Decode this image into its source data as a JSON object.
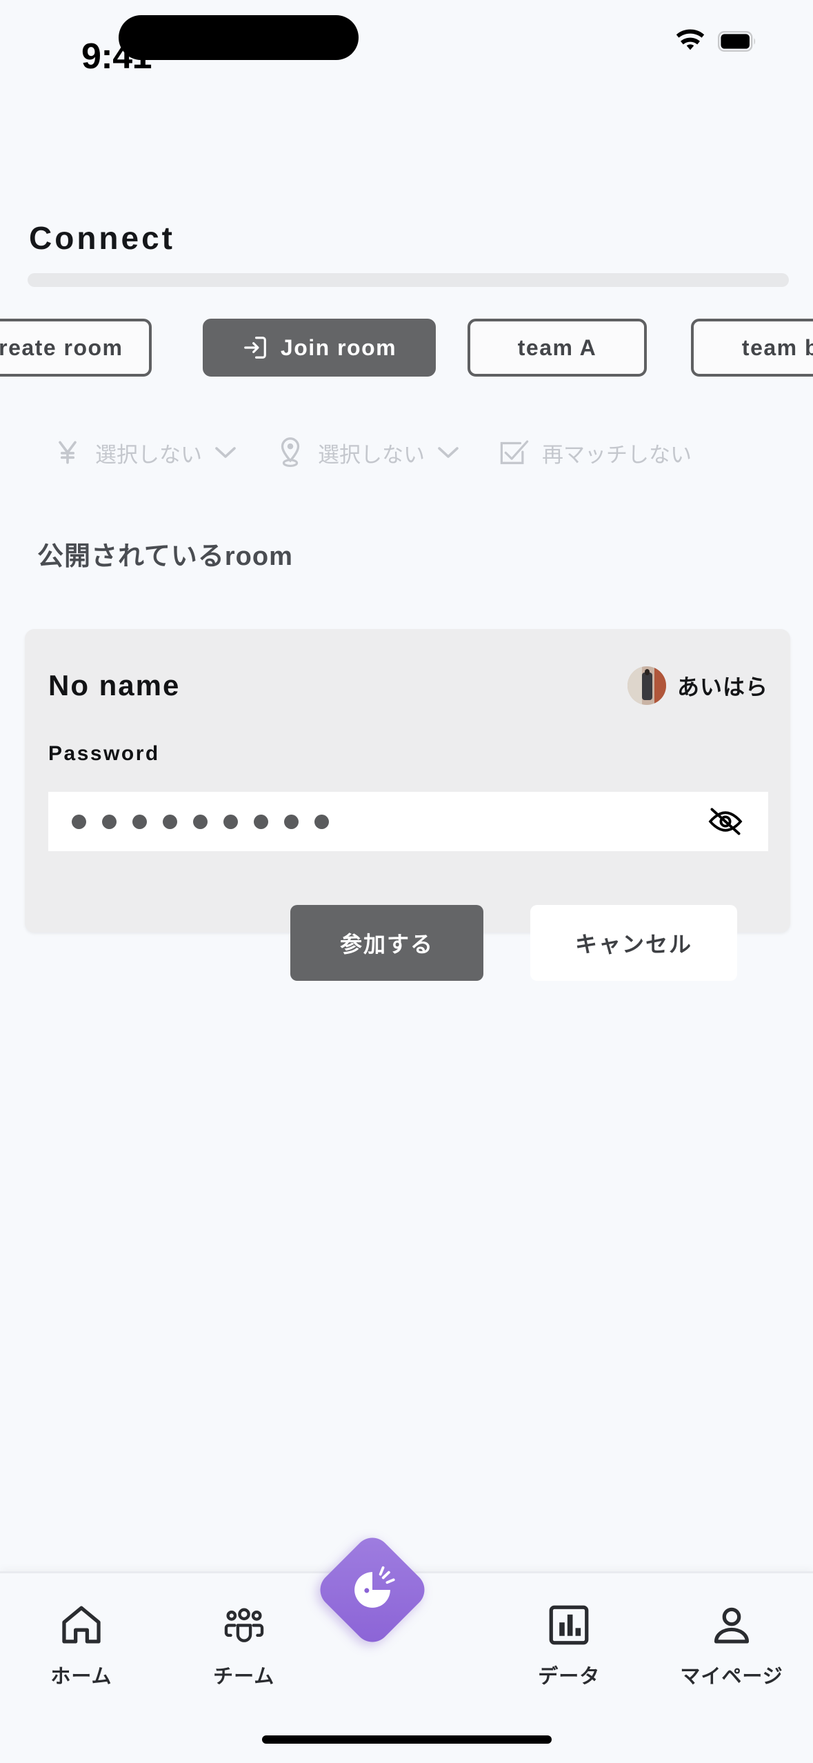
{
  "status_bar": {
    "time": "9:41",
    "wifi_icon": "wifi-icon",
    "battery_icon": "battery-icon",
    "dynamic_island": "dynamic-island"
  },
  "header": {
    "title": "Connect"
  },
  "chips": [
    {
      "label": "Create room",
      "state": "inactive",
      "icon": null
    },
    {
      "label": "Join room",
      "state": "active",
      "icon": "login-arrow-icon"
    },
    {
      "label": "team A",
      "state": "inactive",
      "icon": null
    },
    {
      "label": "team b",
      "state": "inactive",
      "icon": null
    }
  ],
  "filters": [
    {
      "icon": "yen-icon",
      "value": "選択しない",
      "chevron": "chevron-down-icon"
    },
    {
      "icon": "location-pin-icon",
      "value": "選択しない",
      "chevron": "chevron-down-icon"
    },
    {
      "icon": "checkbox-checked-icon",
      "value": "再マッチしない",
      "chevron": null
    }
  ],
  "section": {
    "heading": "公開されているroom"
  },
  "room_card": {
    "name": "No name",
    "owner_name": "あいはら",
    "avatar_icon": "avatar",
    "password_label": "Password",
    "password_dots": 9,
    "password_visibility_icon": "eye-off-icon",
    "join_button": "参加する",
    "cancel_button": "キャンセル"
  },
  "tabbar": {
    "items": [
      {
        "icon": "home-icon",
        "label": "ホーム"
      },
      {
        "icon": "team-group-icon",
        "label": "チーム"
      },
      {
        "icon": "bar-chart-icon",
        "label": "データ"
      },
      {
        "icon": "person-icon",
        "label": "マイページ"
      }
    ],
    "fab_icon": "mascot-pie-icon"
  },
  "colors": {
    "background": "#f7f9fc",
    "card": "#ededee",
    "accent_dark": "#646567",
    "accent_purple": "#8b63d6",
    "muted_text": "#c4c7cd",
    "text": "#15171a"
  }
}
